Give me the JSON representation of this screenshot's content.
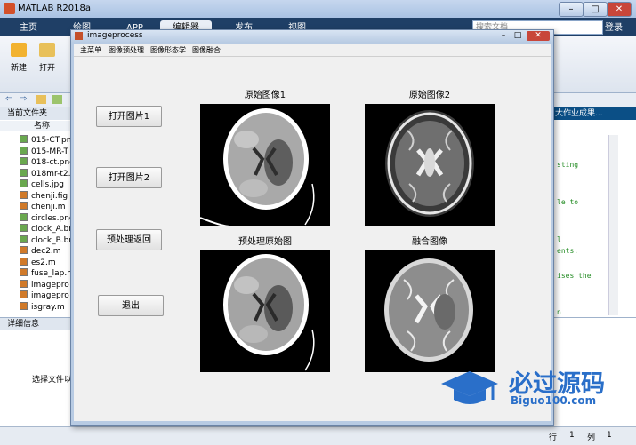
{
  "matlab": {
    "title": "MATLAB R2018a",
    "tabs": [
      "主页",
      "绘图",
      "APP",
      "编辑器",
      "发布",
      "视图"
    ],
    "search_placeholder": "搜索文档",
    "login": "登录",
    "toolstrip": {
      "new_label": "新建",
      "open_label": "打开"
    },
    "current_folder_label": "当前文件夹",
    "name_column": "名称",
    "files": [
      "015-CT.pn",
      "015-MR-T",
      "018-ct.png",
      "018mr-t2.",
      "cells.jpg",
      "chenji.fig",
      "chenji.m",
      "circles.png",
      "clock_A.bn",
      "clock_B.bn",
      "dec2.m",
      "es2.m",
      "fuse_lap.m",
      "imagepro",
      "imagepro",
      "isgray.m"
    ],
    "details_label": "详细信息",
    "details_text": "选择文件以",
    "editor_tab": "大作业成果...",
    "code_lines": [
      "sting",
      "le to",
      "l",
      "ents.",
      "ises the",
      "n"
    ],
    "status": {
      "row_label": "行",
      "row_value": "1",
      "col_label": "列",
      "col_value": "1"
    }
  },
  "figure": {
    "title": "imageprocess",
    "menus": [
      "主菜单",
      "图像预处理",
      "图像形态学",
      "图像融合"
    ],
    "buttons": {
      "open1": "打开图片1",
      "open2": "打开图片2",
      "preprocess": "预处理返回",
      "exit": "退出"
    },
    "captions": {
      "img1": "原始图像1",
      "img2": "原始图像2",
      "pre": "预处理原始图",
      "fused": "融合图像"
    }
  },
  "watermark": {
    "title": "必过源码",
    "url": "Biguo100.com"
  },
  "colors": {
    "accent": "#1f3f66",
    "editor_tab": "#0b4f86",
    "close_button": "#c8463a",
    "watermark": "#2a6fc9"
  }
}
